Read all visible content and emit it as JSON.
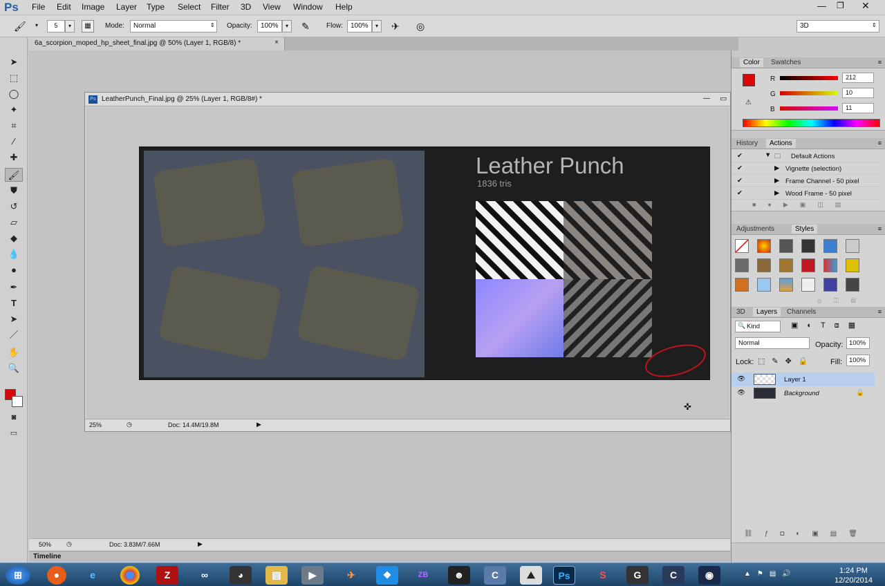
{
  "app": {
    "logo": "Ps"
  },
  "menu": [
    "File",
    "Edit",
    "Image",
    "Layer",
    "Type",
    "Select",
    "Filter",
    "3D",
    "View",
    "Window",
    "Help"
  ],
  "options": {
    "brush_size": "5",
    "mode_label": "Mode:",
    "mode_value": "Normal",
    "opacity_label": "Opacity:",
    "opacity_value": "100%",
    "flow_label": "Flow:",
    "flow_value": "100%",
    "workspace": "3D"
  },
  "doc_tab": {
    "title": "6a_scorpion_moped_hp_sheet_final.jpg @ 50% (Layer 1, RGB/8) *",
    "close": "×"
  },
  "float_window": {
    "title": "LeatherPunch_Final.jpg @ 25% (Layer 1, RGB/8#) *",
    "zoom": "25%",
    "doc_info": "Doc: 14.4M/19.8M",
    "art_title": "Leather Punch",
    "art_subtitle": "1836 tris"
  },
  "main_status": {
    "zoom": "50%",
    "doc_info": "Doc: 3.83M/7.66M"
  },
  "timeline": "Timeline",
  "color_panel": {
    "tabs": [
      "Color",
      "Swatches"
    ],
    "r_label": "R",
    "r": "212",
    "g_label": "G",
    "g": "10",
    "b_label": "B",
    "b": "11",
    "fg_color": "#d40a0b"
  },
  "actions_panel": {
    "tabs": [
      "History",
      "Actions"
    ],
    "items": [
      "Default Actions",
      "Vignette (selection)",
      "Frame Channel - 50 pixel",
      "Wood Frame - 50 pixel"
    ]
  },
  "styles_panel": {
    "tabs": [
      "Adjustments",
      "Styles"
    ]
  },
  "layers_panel": {
    "tabs": [
      "3D",
      "Layers",
      "Channels"
    ],
    "kind": "Kind",
    "blend": "Normal",
    "opacity_label": "Opacity:",
    "opacity": "100%",
    "lock_label": "Lock:",
    "fill_label": "Fill:",
    "fill": "100%",
    "layers": [
      "Layer 1",
      "Background"
    ]
  },
  "taskbar": {
    "time": "1:24 PM",
    "date": "12/20/2014"
  }
}
